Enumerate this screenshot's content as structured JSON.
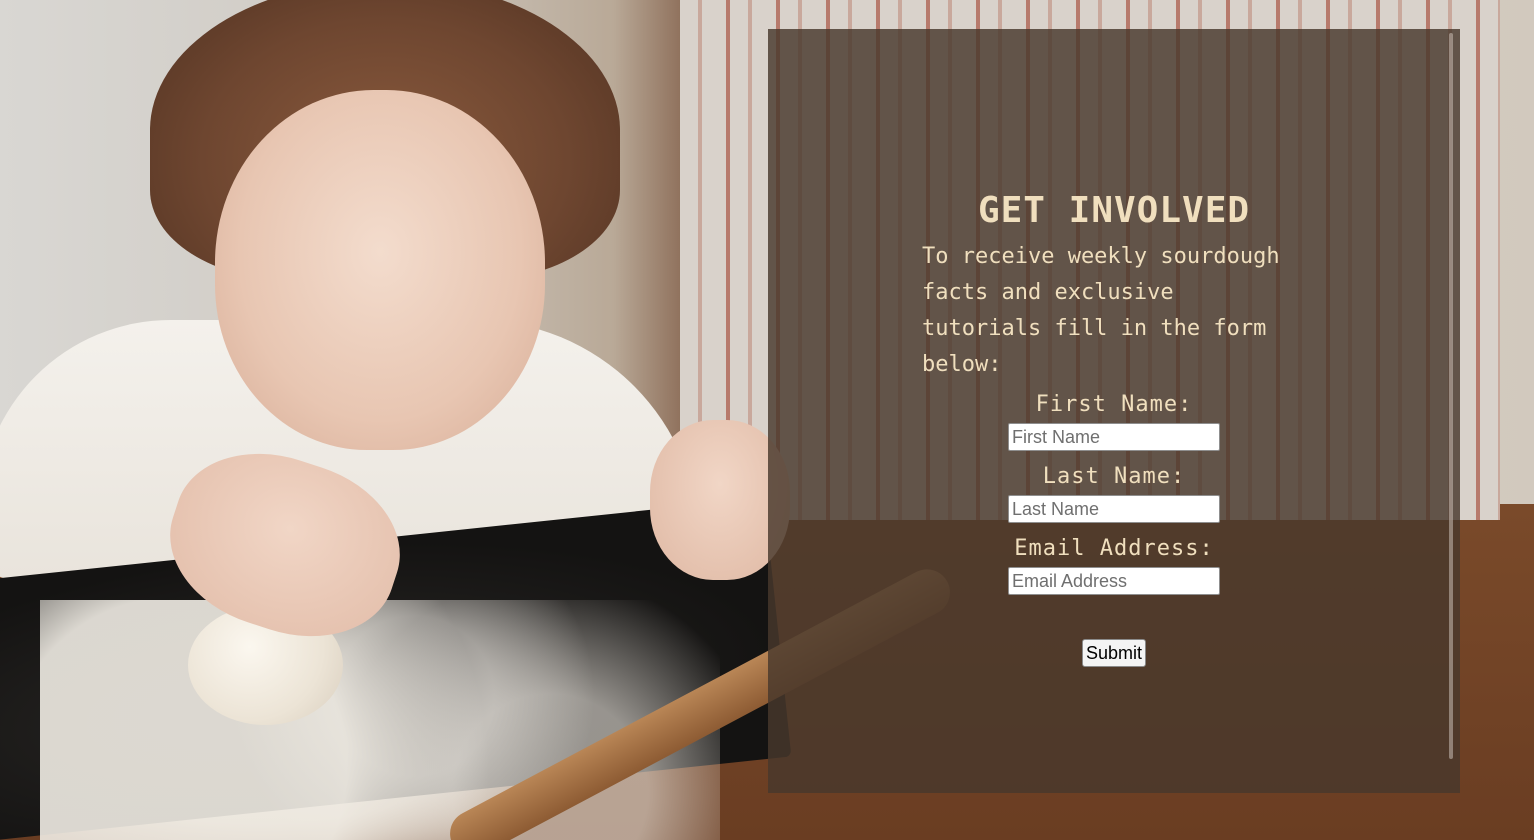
{
  "form": {
    "heading": "GET INVOLVED",
    "intro": "To receive weekly sourdough facts and exclusive tutorials fill in the form below:",
    "fields": [
      {
        "label": "First Name:",
        "placeholder": "First Name",
        "value": ""
      },
      {
        "label": "Last Name:",
        "placeholder": "Last Name",
        "value": ""
      },
      {
        "label": "Email Address:",
        "placeholder": "Email Address",
        "value": ""
      }
    ],
    "submit_label": "Submit"
  },
  "colors": {
    "text": "#f0dfbe",
    "panel_overlay": "rgba(72,56,44,0.82)"
  },
  "background": {
    "photo_semantic": "girl-kneading-dough-photo"
  }
}
